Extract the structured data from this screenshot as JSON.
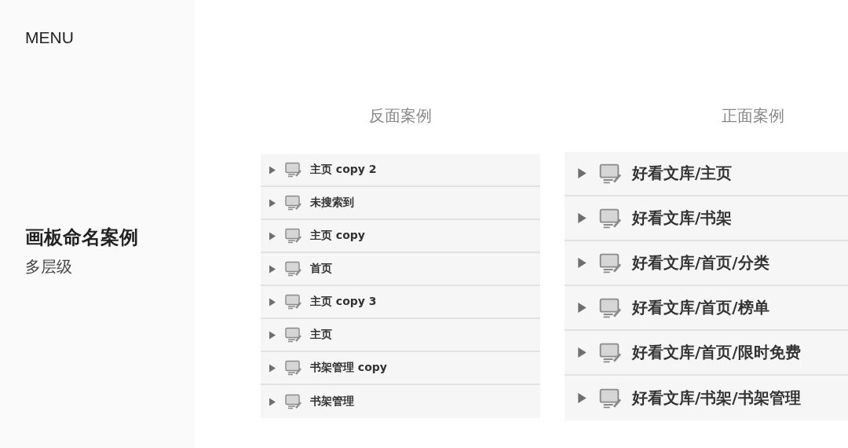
{
  "sidebar": {
    "menu": "MENU",
    "title": "画板命名案例",
    "subtitle": "多层级"
  },
  "examples": [
    {
      "kind": "compact",
      "heading": "反面案例",
      "layers": [
        {
          "name": "主页 copy 2",
          "expanded": false
        },
        {
          "name": "未搜索到",
          "expanded": false
        },
        {
          "name": "主页 copy",
          "expanded": false
        },
        {
          "name": "首页",
          "expanded": false
        },
        {
          "name": "主页 copy 3",
          "expanded": false
        },
        {
          "name": "主页",
          "expanded": false
        },
        {
          "name": "书架管理 copy",
          "expanded": false
        },
        {
          "name": "书架管理",
          "expanded": false
        }
      ]
    },
    {
      "kind": "large",
      "heading": "正面案例",
      "layers": [
        {
          "name": "好看文库/主页",
          "expanded": false
        },
        {
          "name": "好看文库/书架",
          "expanded": false
        },
        {
          "name": "好看文库/首页/分类",
          "expanded": false
        },
        {
          "name": "好看文库/首页/榜单",
          "expanded": false
        },
        {
          "name": "好看文库/首页/限时免费",
          "expanded": false
        },
        {
          "name": "好看文库/书架/书架管理",
          "expanded": false
        }
      ]
    }
  ]
}
